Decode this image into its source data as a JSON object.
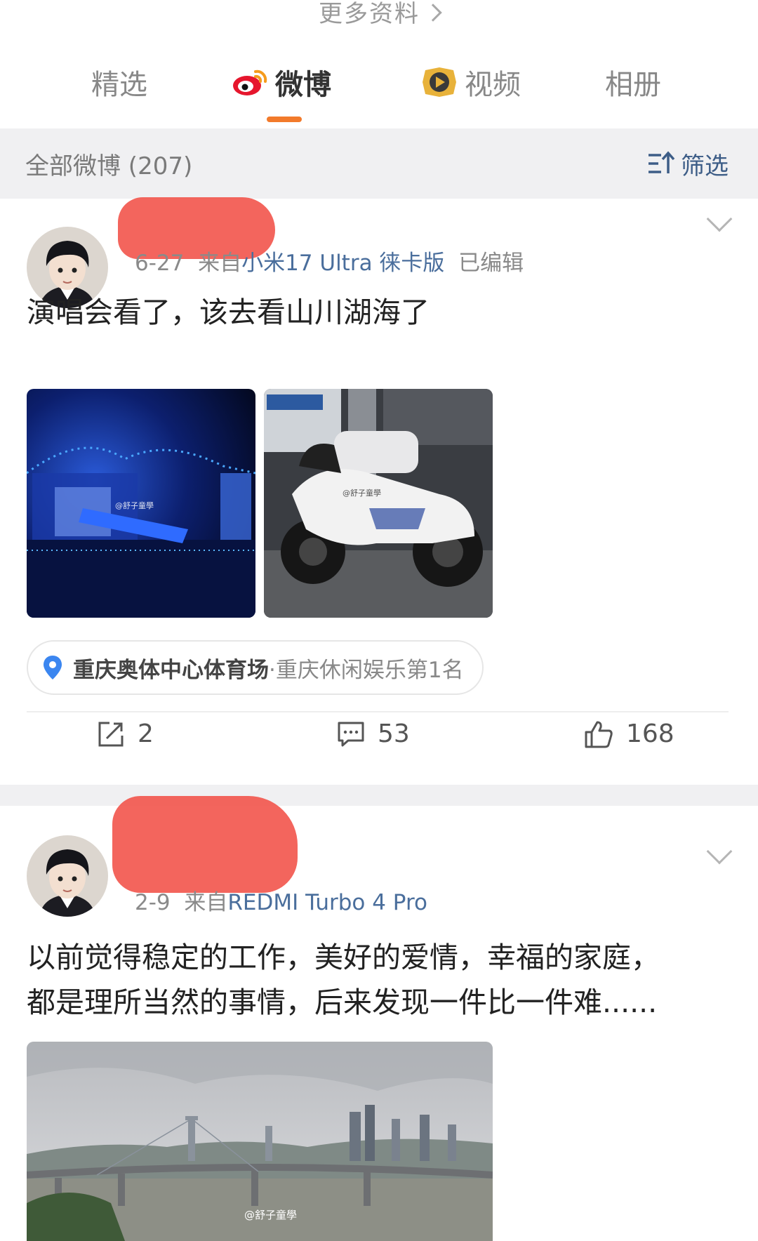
{
  "header": {
    "more_info": "更多资料"
  },
  "tabs": [
    {
      "label": "精选",
      "icon": "none"
    },
    {
      "label": "微博",
      "icon": "weibo-logo-icon",
      "active": true
    },
    {
      "label": "视频",
      "icon": "video-play-icon"
    },
    {
      "label": "相册",
      "icon": "none"
    }
  ],
  "filter_bar": {
    "all_posts_label": "全部微博 (207)",
    "filter_label": "筛选"
  },
  "posts": [
    {
      "date": "6-27",
      "source_prefix": "来自",
      "source": "小米17 Ultra 徕卡版",
      "edited": "已编辑",
      "text": "演唱会看了，该去看山川湖海了",
      "watermark": "@舒子童學",
      "location": {
        "place": "重庆奥体中心体育场",
        "separator": "·",
        "rank": "重庆休闲娱乐第1名"
      },
      "reposts": "2",
      "comments": "53",
      "likes": "168"
    },
    {
      "date": "2-9",
      "source_prefix": "来自",
      "source": "REDMI Turbo 4 Pro",
      "text_line1": "以前觉得稳定的工作，美好的爱情，幸福的家庭，",
      "text_line2": "都是理所当然的事情，后来发现一件比一件难......",
      "watermark": "@舒子童學"
    }
  ],
  "colors": {
    "accent": "#f27a2b",
    "link": "#4a6e9c",
    "filter_bg": "#f0f0f2",
    "redact": "#f2584f"
  }
}
